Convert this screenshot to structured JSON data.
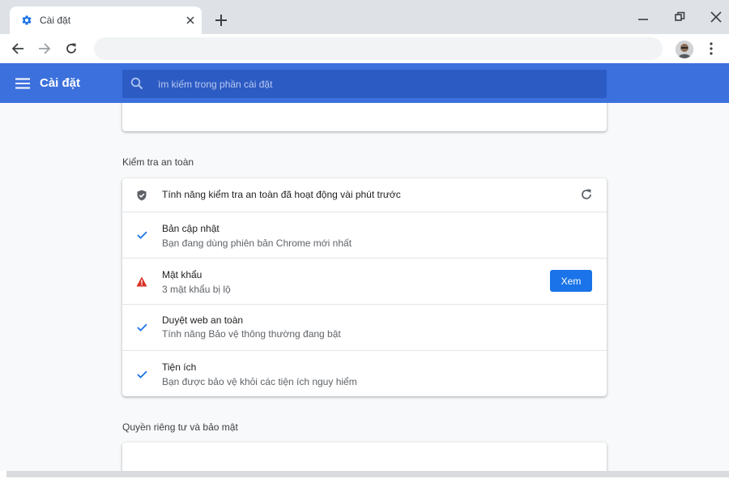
{
  "tab": {
    "title": "Cài đặt"
  },
  "toolbar": {
    "address": ""
  },
  "header": {
    "title": "Cài đặt",
    "search_placeholder": "ìm kiếm trong phần cài đặt"
  },
  "safety": {
    "section_label": "Kiểm tra an toàn",
    "summary": "Tính năng kiểm tra an toàn đã hoạt động vài phút trước",
    "items": [
      {
        "title": "Bản cập nhật",
        "subtitle": "Bạn đang dùng phiên bản Chrome mới nhất",
        "status": "ok"
      },
      {
        "title": "Mật khẩu",
        "subtitle": "3 mật khẩu bị lộ",
        "status": "warning",
        "action_label": "Xem"
      },
      {
        "title": "Duyệt web an toàn",
        "subtitle": "Tính năng Bảo vệ thông thường đang bật",
        "status": "ok"
      },
      {
        "title": "Tiện ích",
        "subtitle": "Bạn được bảo vệ khỏi các tiện ích nguy hiểm",
        "status": "ok"
      }
    ]
  },
  "privacy": {
    "section_label": "Quyền riêng tư và bảo mật"
  },
  "colors": {
    "header_bg": "#3c71dd",
    "search_bg": "#2d5bc4",
    "accent": "#1a73e8",
    "warning": "#d93025",
    "background": "#f8f9fa"
  }
}
